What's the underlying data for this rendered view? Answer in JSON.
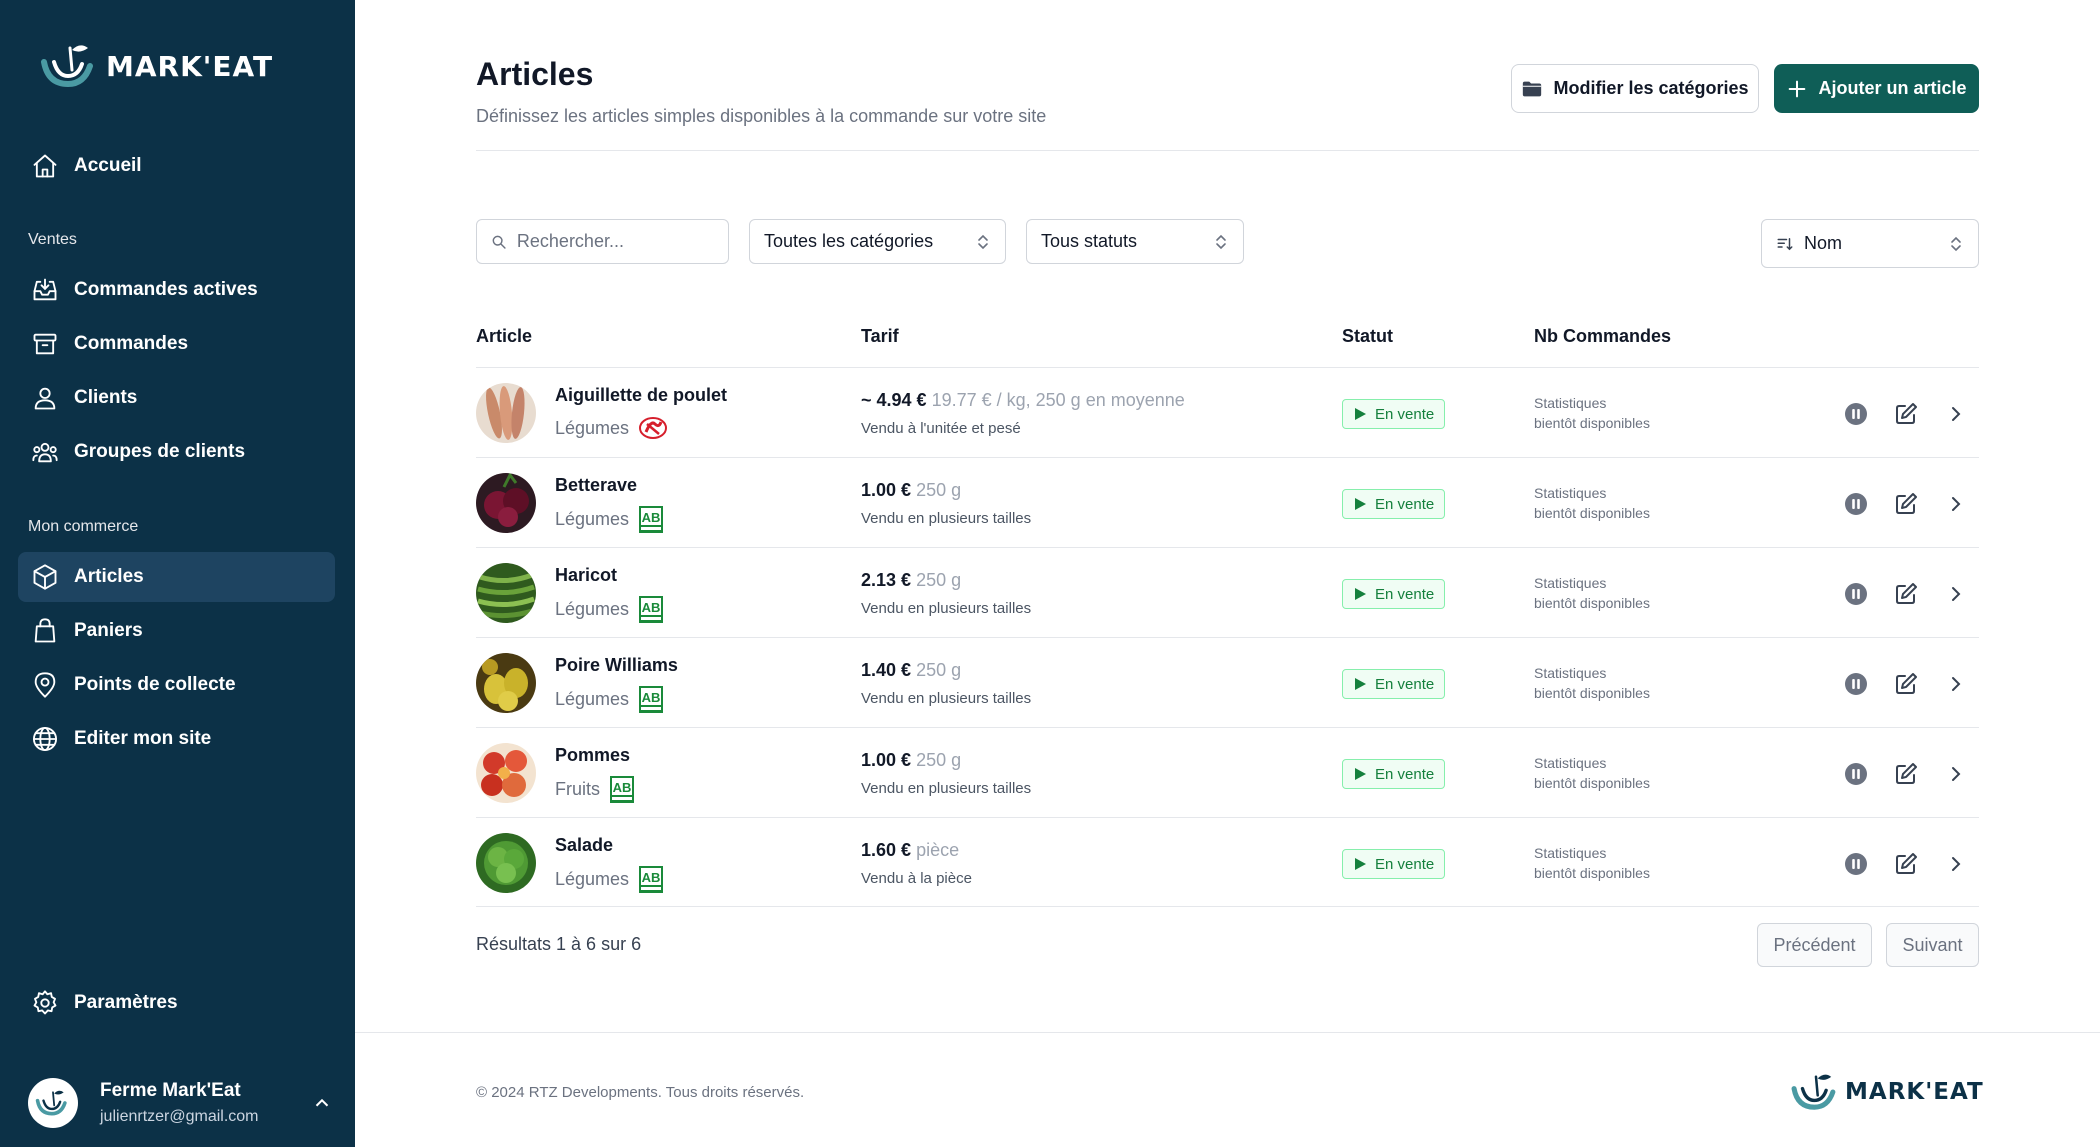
{
  "app": {
    "name": "MARK'EAT"
  },
  "sidebar": {
    "home": "Accueil",
    "section_sales": "Ventes",
    "sales_items": [
      "Commandes actives",
      "Commandes",
      "Clients",
      "Groupes de clients"
    ],
    "section_shop": "Mon commerce",
    "shop_items": [
      "Articles",
      "Paniers",
      "Points de collecte",
      "Editer mon site"
    ],
    "settings": "Paramètres",
    "user": {
      "name": "Ferme Mark'Eat",
      "email": "julienrtzer@gmail.com"
    }
  },
  "header": {
    "title": "Articles",
    "subtitle": "Définissez les articles simples disponibles à la commande sur votre site",
    "edit_categories_label": "Modifier les catégories",
    "add_article_label": "Ajouter un article"
  },
  "filters": {
    "search_placeholder": "Rechercher...",
    "category_value": "Toutes les catégories",
    "status_value": "Tous statuts",
    "sort_value": "Nom"
  },
  "table": {
    "columns": [
      "Article",
      "Tarif",
      "Statut",
      "Nb Commandes"
    ],
    "rows": [
      {
        "name": "Aiguillette de poulet",
        "category": "Légumes",
        "label": "label-rouge",
        "price": "~ 4.94 €",
        "unit": "19.77 € / kg, 250 g en moyenne",
        "note": "Vendu à l'unitée et pesé",
        "status": "En vente",
        "stats_1": "Statistiques",
        "stats_2": "bientôt disponibles"
      },
      {
        "name": "Betterave",
        "category": "Légumes",
        "label": "ab",
        "price": "1.00 €",
        "unit": "250 g",
        "note": "Vendu en plusieurs tailles",
        "status": "En vente",
        "stats_1": "Statistiques",
        "stats_2": "bientôt disponibles"
      },
      {
        "name": "Haricot",
        "category": "Légumes",
        "label": "ab",
        "price": "2.13 €",
        "unit": "250 g",
        "note": "Vendu en plusieurs tailles",
        "status": "En vente",
        "stats_1": "Statistiques",
        "stats_2": "bientôt disponibles"
      },
      {
        "name": "Poire Williams",
        "category": "Légumes",
        "label": "ab",
        "price": "1.40 €",
        "unit": "250 g",
        "note": "Vendu en plusieurs tailles",
        "status": "En vente",
        "stats_1": "Statistiques",
        "stats_2": "bientôt disponibles"
      },
      {
        "name": "Pommes",
        "category": "Fruits",
        "label": "ab",
        "price": "1.00 €",
        "unit": "250 g",
        "note": "Vendu en plusieurs tailles",
        "status": "En vente",
        "stats_1": "Statistiques",
        "stats_2": "bientôt disponibles"
      },
      {
        "name": "Salade",
        "category": "Légumes",
        "label": "ab",
        "price": "1.60 €",
        "unit": "pièce",
        "note": "Vendu à la pièce",
        "status": "En vente",
        "stats_1": "Statistiques",
        "stats_2": "bientôt disponibles"
      }
    ]
  },
  "pagination": {
    "results": "Résultats 1 à 6 sur 6",
    "prev": "Précédent",
    "next": "Suivant"
  },
  "footer": {
    "copyright": "© 2024 RTZ Developments. Tous droits réservés."
  },
  "colors": {
    "sidebar": "#0c3147",
    "active_nav": "#1e4461",
    "primary": "#0f5e57",
    "status_green": "#15803d"
  }
}
